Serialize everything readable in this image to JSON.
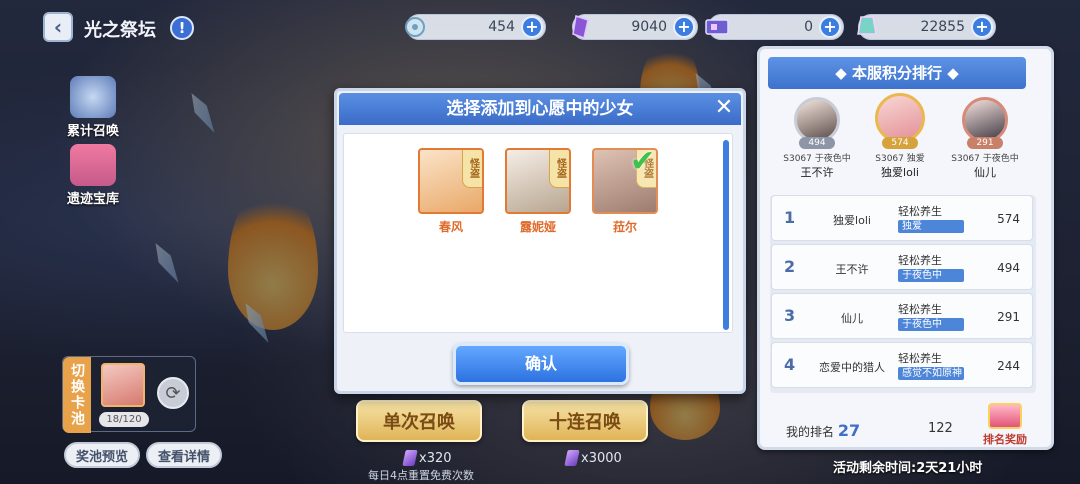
{
  "header": {
    "title": "光之祭坛"
  },
  "currencies": [
    {
      "icon": "stamina-icon",
      "value": "454"
    },
    {
      "icon": "purple-crystal-icon",
      "value": "9040"
    },
    {
      "icon": "ticket-icon",
      "value": "0"
    },
    {
      "icon": "rainbow-gem-icon",
      "value": "22855"
    }
  ],
  "side_menu": {
    "cumulative": "累计召唤",
    "shop": "遗迹宝库"
  },
  "pool": {
    "switch_label": "切换卡池",
    "count": "18/120",
    "preview": "奖池预览",
    "details": "查看详情"
  },
  "summon": {
    "single": "单次召唤",
    "ten": "十连召唤",
    "single_cost": "x320",
    "ten_cost": "x3000",
    "daily_note": "每日4点重置免费次数"
  },
  "modal": {
    "title": "选择添加到心愿中的少女",
    "characters": [
      {
        "name": "春风",
        "badge": "怪盗",
        "selected": false
      },
      {
        "name": "露妮娅",
        "badge": "怪盗",
        "selected": false
      },
      {
        "name": "菈尔",
        "badge": "怪盗",
        "selected": true
      }
    ],
    "confirm": "确认"
  },
  "ranking": {
    "title": "本服积分排行",
    "top3": [
      {
        "score": "494",
        "server": "S3067 于夜色中",
        "name": "王不许"
      },
      {
        "score": "574",
        "server": "S3067 独爱",
        "name": "独爱loli"
      },
      {
        "score": "291",
        "server": "S3067 于夜色中",
        "name": "仙儿"
      }
    ],
    "rows": [
      {
        "rank": "1",
        "name": "独爱loli",
        "guild": "轻松养生",
        "tag": "独爱",
        "score": "574"
      },
      {
        "rank": "2",
        "name": "王不许",
        "guild": "轻松养生",
        "tag": "于夜色中",
        "score": "494"
      },
      {
        "rank": "3",
        "name": "仙儿",
        "guild": "轻松养生",
        "tag": "于夜色中",
        "score": "291"
      },
      {
        "rank": "4",
        "name": "恋爱中的猎人",
        "guild": "轻松养生",
        "tag": "感觉不如原神",
        "score": "244"
      }
    ],
    "my_rank_label": "我的排名",
    "my_rank": "27",
    "my_score": "122",
    "reward": "排名奖励",
    "timer": "活动剩余时间:2天21小时"
  }
}
